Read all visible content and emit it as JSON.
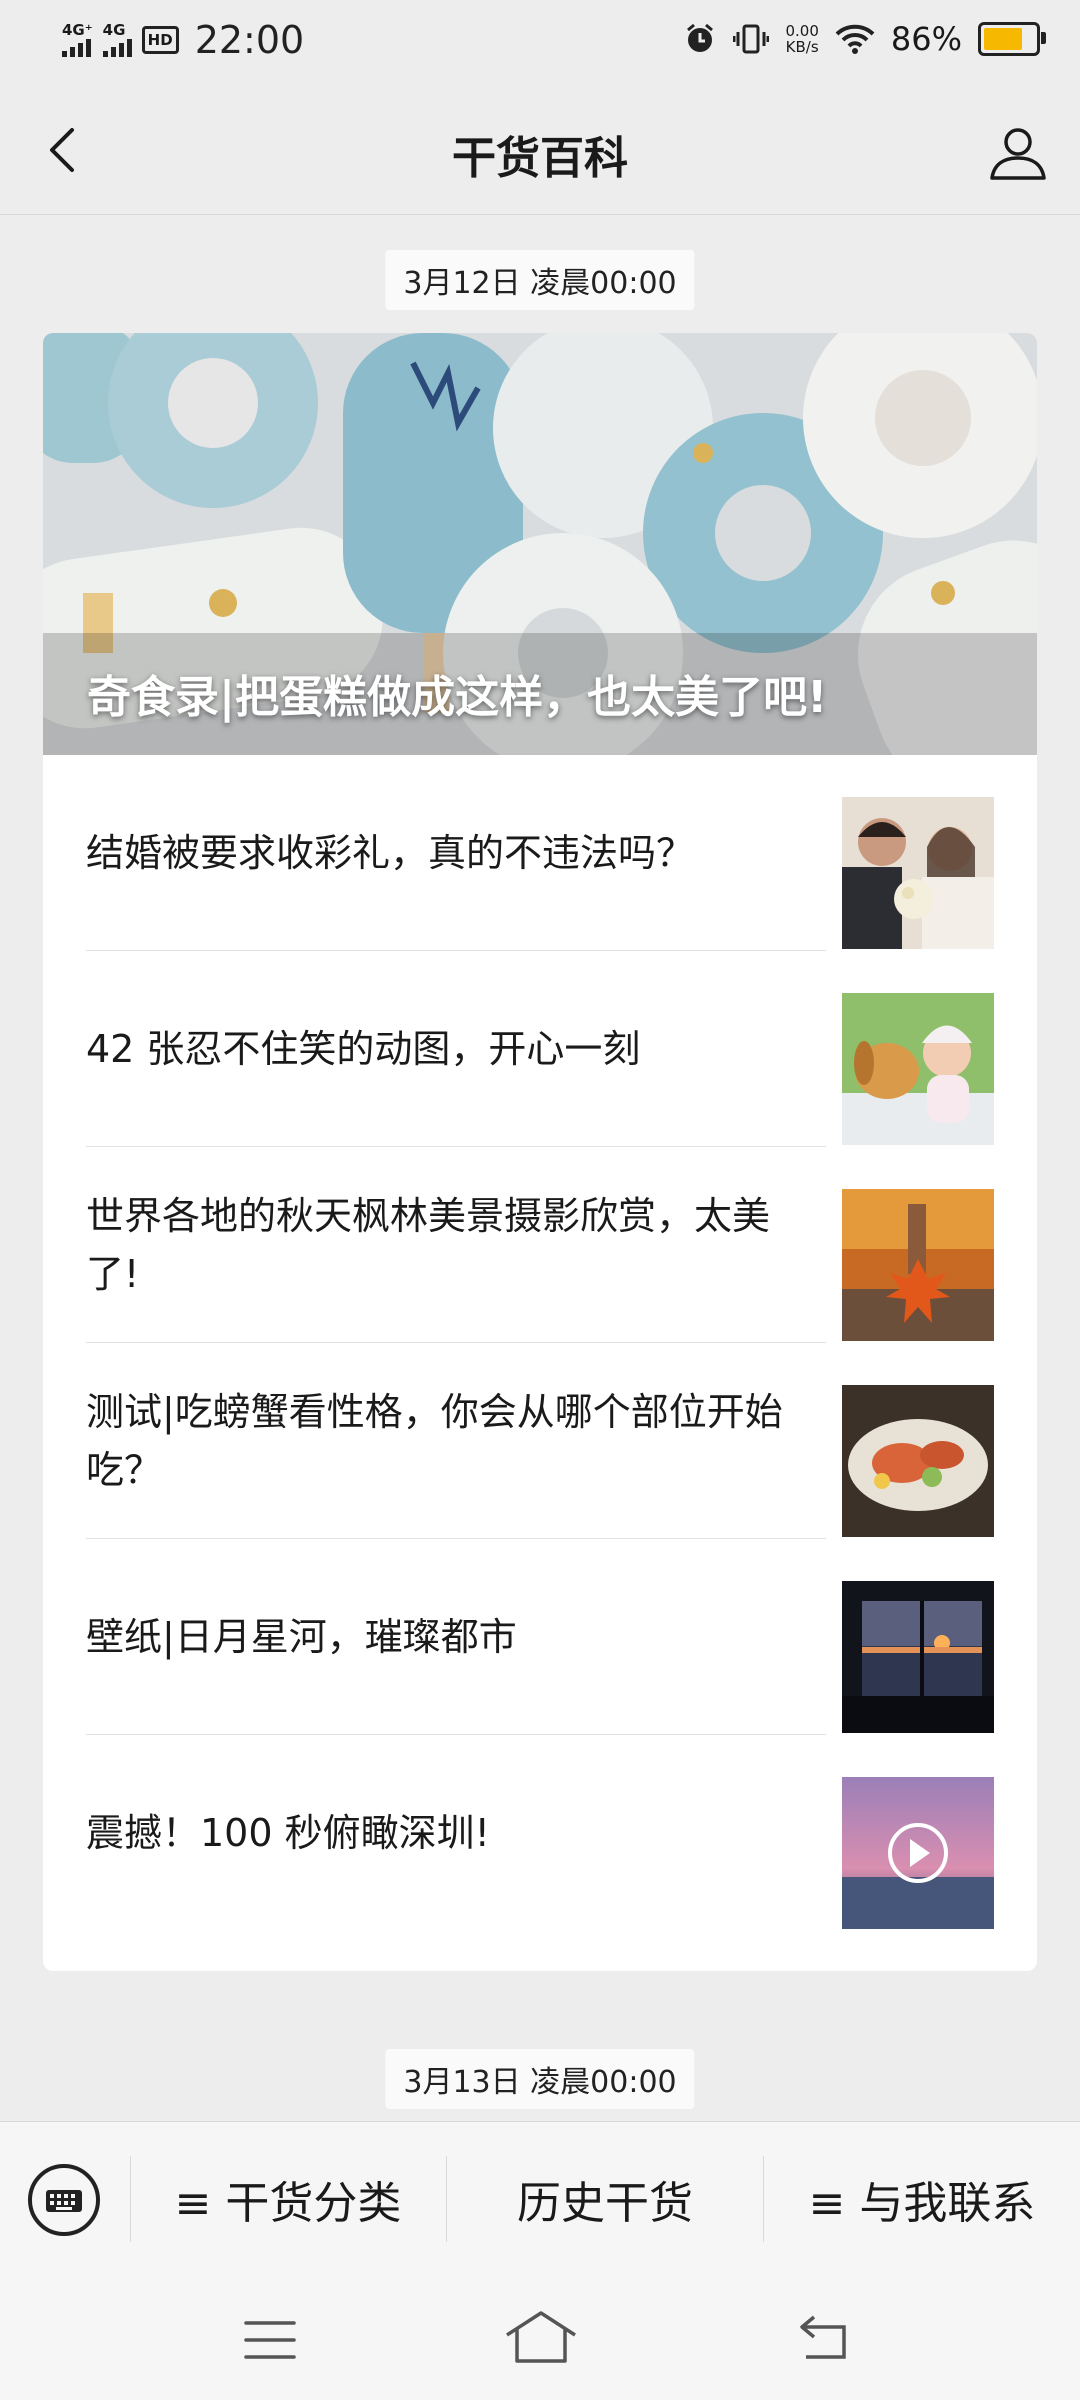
{
  "status_bar": {
    "sim1": "4G⁺",
    "sim2": "4G",
    "hd": "HD",
    "time": "22:00",
    "net_speed_value": "0.00",
    "net_speed_unit": "KB/s",
    "battery_percent": "86%",
    "battery_level": 0.86,
    "battery_color": "#f6b800"
  },
  "nav": {
    "back_icon": "chevron-left-icon",
    "title": "干货百科",
    "profile_icon": "person-icon"
  },
  "feed": [
    {
      "date": "3月12日 凌晨00:00",
      "hero_title": "奇食录|把蛋糕做成这样，也太美了吧!",
      "items": [
        {
          "title": "结婚被要求收彩礼，真的不违法吗？",
          "thumb": "wedding-couple-photo"
        },
        {
          "title": "42 张忍不住笑的动图，开心一刻",
          "thumb": "puppy-and-baby-photo"
        },
        {
          "title": "世界各地的秋天枫林美景摄影欣赏，太美了!",
          "thumb": "autumn-maple-leaf-photo"
        },
        {
          "title": "测试|吃螃蟹看性格，你会从哪个部位开始吃？",
          "thumb": "crab-dish-photo"
        },
        {
          "title": "壁纸|日月星河，璀璨都市",
          "thumb": "sunset-window-photo"
        },
        {
          "title": "震撼！100 秒俯瞰深圳!",
          "thumb": "shenzhen-video-thumbnail"
        }
      ]
    },
    {
      "date": "3月13日 凌晨00:00"
    }
  ],
  "bottom_menu": {
    "keyboard_icon": "keyboard-icon",
    "items": [
      {
        "label": "≡ 干货分类"
      },
      {
        "label": "历史干货"
      },
      {
        "label": "≡ 与我联系"
      }
    ]
  },
  "system_nav": {
    "menu_icon": "menu-icon",
    "home_icon": "home-icon",
    "back_icon": "back-arrow-icon"
  }
}
